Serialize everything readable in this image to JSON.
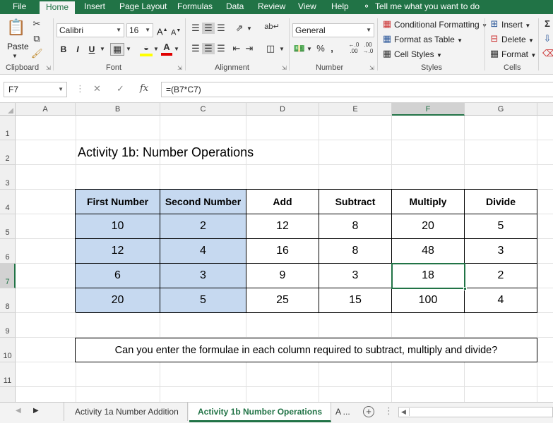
{
  "menu": {
    "tabs": [
      {
        "label": "File"
      },
      {
        "label": "Home"
      },
      {
        "label": "Insert"
      },
      {
        "label": "Page Layout"
      },
      {
        "label": "Formulas"
      },
      {
        "label": "Data"
      },
      {
        "label": "Review"
      },
      {
        "label": "View"
      },
      {
        "label": "Help"
      }
    ],
    "tell_me": "Tell me what you want to do"
  },
  "ribbon": {
    "clipboard": {
      "label": "Clipboard",
      "paste": "Paste"
    },
    "font": {
      "label": "Font",
      "name": "Calibri",
      "size": "16",
      "grow": "A",
      "shrink": "A",
      "bold": "B",
      "italic": "I",
      "underline": "U",
      "font_color_glyph": "A"
    },
    "alignment": {
      "label": "Alignment"
    },
    "number": {
      "label": "Number",
      "format": "General",
      "percent": "%",
      "comma": ","
    },
    "styles": {
      "label": "Styles",
      "conditional": "Conditional Formatting",
      "table": "Format as Table",
      "cell_styles": "Cell Styles"
    },
    "cells": {
      "label": "Cells",
      "insert": "Insert",
      "delete": "Delete",
      "format": "Format"
    }
  },
  "formula_bar": {
    "name_box": "F7",
    "fx": "fx",
    "formula": "=(B7*C7)"
  },
  "grid": {
    "columns": [
      "A",
      "B",
      "C",
      "D",
      "E",
      "F",
      "G"
    ],
    "rows": [
      "1",
      "2",
      "3",
      "4",
      "5",
      "6",
      "7",
      "8",
      "9",
      "10",
      "11"
    ],
    "selected_column": "F",
    "selected_row": "7"
  },
  "sheet": {
    "title": "Activity 1b: Number Operations",
    "headers": [
      "First Number",
      "Second Number",
      "Add",
      "Subtract",
      "Multiply",
      "Divide"
    ],
    "rows": [
      [
        "10",
        "2",
        "12",
        "8",
        "20",
        "5"
      ],
      [
        "12",
        "4",
        "16",
        "8",
        "48",
        "3"
      ],
      [
        "6",
        "3",
        "9",
        "3",
        "18",
        "2"
      ],
      [
        "20",
        "5",
        "25",
        "15",
        "100",
        "4"
      ]
    ],
    "note": "Can you enter the formulae in each column required to subtract, multiply and divide?"
  },
  "tabs": {
    "items": [
      "Activity 1a Number Addition",
      "Activity 1b Number Operations",
      "A ..."
    ],
    "add_glyph": "+"
  },
  "colors": {
    "accent": "#217346",
    "input_fill": "#c6d9f0"
  }
}
